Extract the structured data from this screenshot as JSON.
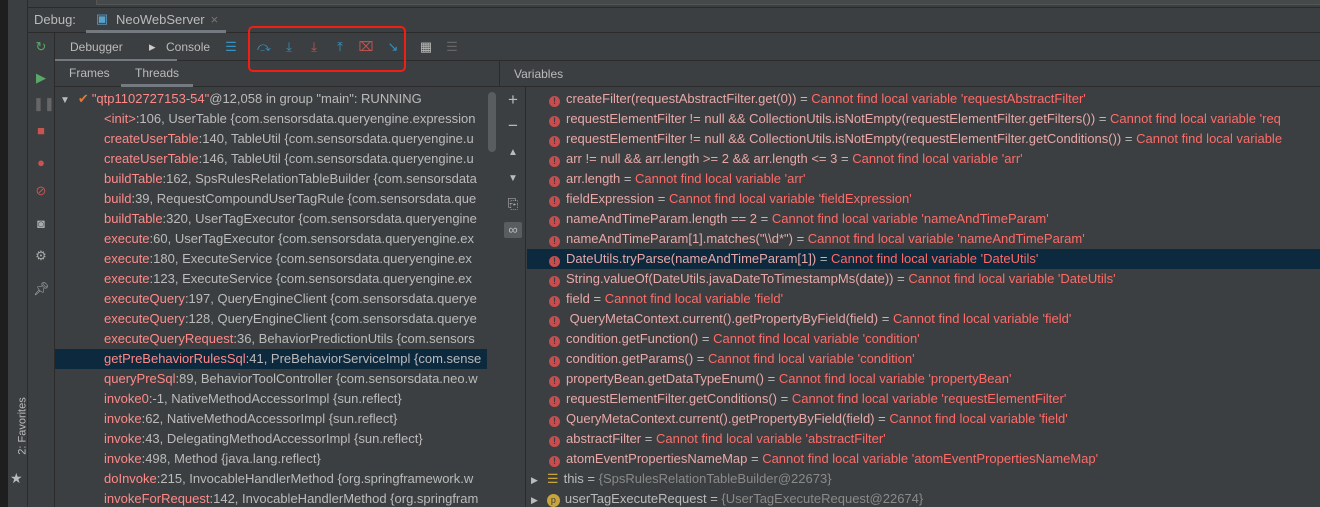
{
  "debug": {
    "label": "Debug:",
    "session": "NeoWebServer"
  },
  "toolbar": {
    "debugger": "Debugger",
    "console": "Console"
  },
  "tabs": {
    "frames": "Frames",
    "threads": "Threads"
  },
  "favorites": "2: Favorites",
  "variables_title": "Variables",
  "thread": {
    "name": "\"qtp1102727153-54\"",
    "rest": "@12,058 in group \"main\": RUNNING"
  },
  "frames": [
    {
      "m": "<init>",
      "r": ":106, UserTable {com.sensorsdata.queryengine.expression"
    },
    {
      "m": "createUserTable",
      "r": ":140, TableUtil {com.sensorsdata.queryengine.u"
    },
    {
      "m": "createUserTable",
      "r": ":146, TableUtil {com.sensorsdata.queryengine.u"
    },
    {
      "m": "buildTable",
      "r": ":162, SpsRulesRelationTableBuilder {com.sensorsdata"
    },
    {
      "m": "build",
      "r": ":39, RequestCompoundUserTagRule {com.sensorsdata.que"
    },
    {
      "m": "buildTable",
      "r": ":320, UserTagExecutor {com.sensorsdata.queryengine"
    },
    {
      "m": "execute",
      "r": ":60, UserTagExecutor {com.sensorsdata.queryengine.ex"
    },
    {
      "m": "execute",
      "r": ":180, ExecuteService {com.sensorsdata.queryengine.ex"
    },
    {
      "m": "execute",
      "r": ":123, ExecuteService {com.sensorsdata.queryengine.ex"
    },
    {
      "m": "executeQuery",
      "r": ":197, QueryEngineClient {com.sensorsdata.querye"
    },
    {
      "m": "executeQuery",
      "r": ":128, QueryEngineClient {com.sensorsdata.querye"
    },
    {
      "m": "executeQueryRequest",
      "r": ":36, BehaviorPredictionUtils {com.sensors"
    },
    {
      "m": "getPreBehaviorRulesSql",
      "r": ":41, PreBehaviorServiceImpl {com.sense"
    },
    {
      "m": "queryPreSql",
      "r": ":89, BehaviorToolController {com.sensorsdata.neo.w"
    },
    {
      "m": "invoke0",
      "r": ":-1, NativeMethodAccessorImpl {sun.reflect}"
    },
    {
      "m": "invoke",
      "r": ":62, NativeMethodAccessorImpl {sun.reflect}"
    },
    {
      "m": "invoke",
      "r": ":43, DelegatingMethodAccessorImpl {sun.reflect}"
    },
    {
      "m": "invoke",
      "r": ":498, Method {java.lang.reflect}"
    },
    {
      "m": "doInvoke",
      "r": ":215, InvocableHandlerMethod {org.springframework.w"
    },
    {
      "m": "invokeForRequest",
      "r": ":142, InvocableHandlerMethod {org.springfram"
    }
  ],
  "selected_frame": 12,
  "watches": [
    {
      "e": "createFilter(requestAbstractFilter.get(0))",
      "v": "Cannot find local variable 'requestAbstractFilter'"
    },
    {
      "e": "requestElementFilter != null && CollectionUtils.isNotEmpty(requestElementFilter.getFilters())",
      "v": "Cannot find local variable 'req"
    },
    {
      "e": "requestElementFilter != null && CollectionUtils.isNotEmpty(requestElementFilter.getConditions())",
      "v": "Cannot find local variable"
    },
    {
      "e": "arr != null && arr.length >= 2 && arr.length <= 3",
      "v": "Cannot find local variable 'arr'"
    },
    {
      "e": "arr.length",
      "v": "Cannot find local variable 'arr'"
    },
    {
      "e": "fieldExpression",
      "v": "Cannot find local variable 'fieldExpression'"
    },
    {
      "e": "nameAndTimeParam.length == 2",
      "v": "Cannot find local variable 'nameAndTimeParam'"
    },
    {
      "e": "nameAndTimeParam[1].matches(\"\\\\d*\")",
      "v": "Cannot find local variable 'nameAndTimeParam'"
    },
    {
      "e": "DateUtils.tryParse(nameAndTimeParam[1])",
      "v": "Cannot find local variable 'DateUtils'"
    },
    {
      "e": "String.valueOf(DateUtils.javaDateToTimestampMs(date))",
      "v": "Cannot find local variable 'DateUtils'"
    },
    {
      "e": "field",
      "v": "Cannot find local variable 'field'"
    },
    {
      "e": " QueryMetaContext.current().getPropertyByField(field)",
      "v": "Cannot find local variable 'field'"
    },
    {
      "e": "condition.getFunction()",
      "v": "Cannot find local variable 'condition'"
    },
    {
      "e": "condition.getParams()",
      "v": "Cannot find local variable 'condition'"
    },
    {
      "e": "propertyBean.getDataTypeEnum()",
      "v": "Cannot find local variable 'propertyBean'"
    },
    {
      "e": "requestElementFilter.getConditions()",
      "v": "Cannot find local variable 'requestElementFilter'"
    },
    {
      "e": "QueryMetaContext.current().getPropertyByField(field)",
      "v": "Cannot find local variable 'field'"
    },
    {
      "e": "abstractFilter",
      "v": "Cannot find local variable 'abstractFilter'"
    },
    {
      "e": "atomEventPropertiesNameMap",
      "v": "Cannot find local variable 'atomEventPropertiesNameMap'"
    }
  ],
  "selected_watch": 8,
  "objects": [
    {
      "n": "this",
      "v": "{SpsRulesRelationTableBuilder@22673}",
      "icon": "field-icon"
    },
    {
      "n": "userTagExecuteRequest",
      "v": "{UserTagExecuteRequest@22674}",
      "icon": "parameter-icon"
    }
  ],
  "colors": {
    "background": "#3c3f41",
    "selection": "#0d293e",
    "error": "#ff6b68",
    "highlight_box": "#f01e14",
    "step_blue": "#3592c4",
    "step_red": "#c75450"
  }
}
